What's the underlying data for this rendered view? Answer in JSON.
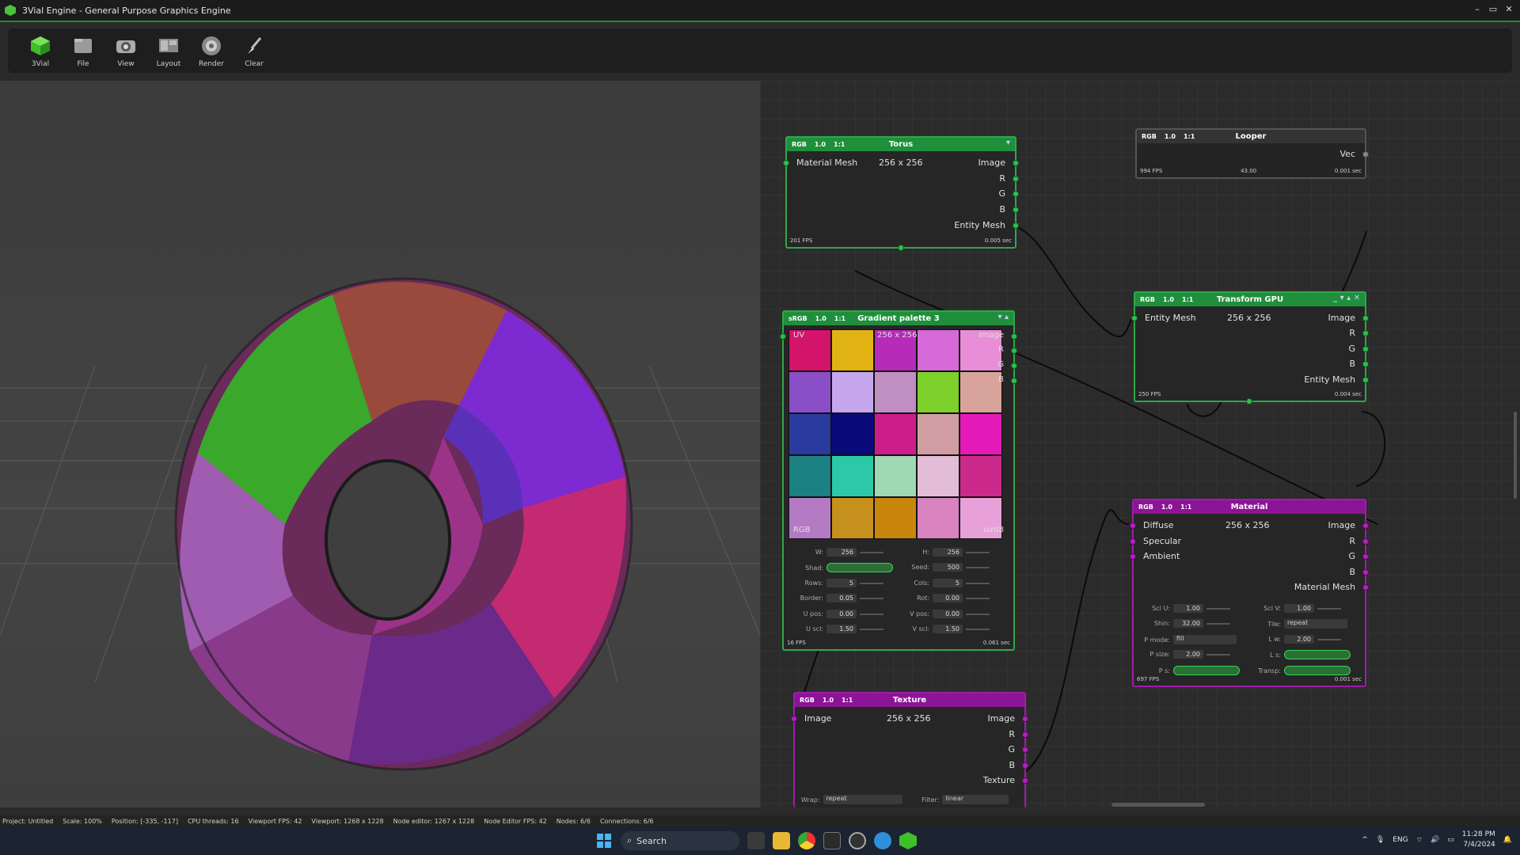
{
  "window": {
    "title": "3Vial Engine - General Purpose Graphics Engine",
    "controls": [
      "–",
      "▭",
      "✕"
    ]
  },
  "toolbar": {
    "items": [
      {
        "label": "3Vial",
        "icon": "cube-logo-icon"
      },
      {
        "label": "File",
        "icon": "file-icon"
      },
      {
        "label": "View",
        "icon": "camera-icon"
      },
      {
        "label": "Layout",
        "icon": "layout-icon"
      },
      {
        "label": "Render",
        "icon": "render-icon"
      },
      {
        "label": "Clear",
        "icon": "brush-icon"
      }
    ]
  },
  "nodes": {
    "torus": {
      "tag": "RGB",
      "scale": "1.0",
      "ratio": "1:1",
      "title": "Torus",
      "input": "Material Mesh",
      "size": "256 x 256",
      "outputs": [
        "Image",
        "R",
        "G",
        "B",
        "Entity Mesh"
      ],
      "fps": "201 FPS",
      "time": "0.005 sec"
    },
    "looper": {
      "tag": "RGB",
      "scale": "1.0",
      "ratio": "1:1",
      "title": "Looper",
      "output": "Vec",
      "fps": "994 FPS",
      "mid": "43.00",
      "time": "0.001 sec"
    },
    "gradient": {
      "tag": "sRGB",
      "scale": "1.0",
      "ratio": "1:1",
      "title": "Gradient palette 3",
      "corner_tl": "UV",
      "size": "256 x 256",
      "corner_tr": "Image",
      "channels": [
        "R",
        "G",
        "B"
      ],
      "corner_bl": "RGB",
      "corner_br": "uint8",
      "colors": [
        "#d3146a",
        "#e1b414",
        "#b62bb8",
        "#d56ad8",
        "#e88ed6",
        "#8a4fc7",
        "#c6a7ee",
        "#c08fc2",
        "#7ed02a",
        "#d7a39a",
        "#2a3a9c",
        "#0a0a7a",
        "#cc1e8a",
        "#d09ea2",
        "#e41ab8",
        "#1d8082",
        "#2cc9a8",
        "#9ed8b4",
        "#e3bcd8",
        "#cc2a8a",
        "#b47ac4",
        "#c6901c",
        "#c8860c",
        "#d882c0",
        "#e8a0d8"
      ],
      "params_left": [
        {
          "label": "W:",
          "value": "256"
        },
        {
          "label": "Shad:",
          "value": ""
        },
        {
          "label": "Rows:",
          "value": "5"
        },
        {
          "label": "Border:",
          "value": "0.05"
        },
        {
          "label": "U pos:",
          "value": "0.00"
        },
        {
          "label": "U scl:",
          "value": "1.50"
        }
      ],
      "params_right": [
        {
          "label": "H:",
          "value": "256"
        },
        {
          "label": "Seed:",
          "value": "500"
        },
        {
          "label": "Cols:",
          "value": "5"
        },
        {
          "label": "Rot:",
          "value": "0.00"
        },
        {
          "label": "V pos:",
          "value": "0.00"
        },
        {
          "label": "V scl:",
          "value": "1.50"
        }
      ],
      "fps": "16 FPS",
      "time": "0.061 sec"
    },
    "transform": {
      "tag": "RGB",
      "scale": "1.0",
      "ratio": "1:1",
      "title": "Transform GPU",
      "input": "Entity Mesh",
      "size": "256 x 256",
      "outputs": [
        "Image",
        "R",
        "G",
        "B",
        "Entity Mesh"
      ],
      "fps": "250 FPS",
      "time": "0.004 sec"
    },
    "material": {
      "tag": "RGB",
      "scale": "1.0",
      "ratio": "1:1",
      "title": "Material",
      "inputs": [
        "Diffuse",
        "Specular",
        "Ambient"
      ],
      "size": "256 x 256",
      "outputs": [
        "Image",
        "R",
        "G",
        "B",
        "Material Mesh"
      ],
      "params_left": [
        {
          "label": "Scl U:",
          "value": "1.00"
        },
        {
          "label": "Shin:",
          "value": "32.00"
        },
        {
          "label": "P mode:",
          "value": "fill"
        },
        {
          "label": "P size:",
          "value": "2.00"
        },
        {
          "label": "P s:",
          "value": ""
        }
      ],
      "params_right": [
        {
          "label": "Scl V:",
          "value": "1.00"
        },
        {
          "label": "Tile:",
          "value": "repeat"
        },
        {
          "label": "L w:",
          "value": "2.00"
        },
        {
          "label": "L s:",
          "value": ""
        },
        {
          "label": "Transp:",
          "value": ""
        }
      ],
      "fps": "697 FPS",
      "time": "0.001 sec"
    },
    "texture": {
      "tag": "RGB",
      "scale": "1.0",
      "ratio": "1:1",
      "title": "Texture",
      "input": "Image",
      "size": "256 x 256",
      "outputs": [
        "Image",
        "R",
        "G",
        "B",
        "Texture"
      ],
      "wrap_label": "Wrap:",
      "wrap_value": "repeat",
      "filter_label": "Filter:",
      "filter_value": "linear"
    }
  },
  "status": {
    "items": [
      "Project: Untitled",
      "Scale: 100%",
      "Position: [-335, -117]",
      "CPU threads: 16",
      "Viewport FPS: 42",
      "Viewport: 1268 x 1228",
      "Node editor: 1267 x 1228",
      "Node Editor FPS: 42",
      "Nodes: 6/6",
      "Connections: 6/6"
    ]
  },
  "taskbar": {
    "search_label": "Search",
    "lang": "ENG",
    "time": "11:28 PM",
    "date": "7/4/2024"
  },
  "colors": {
    "node_green": "#2fa84a",
    "node_violet": "#a01caa",
    "title_accent": "#1f8a3a"
  }
}
